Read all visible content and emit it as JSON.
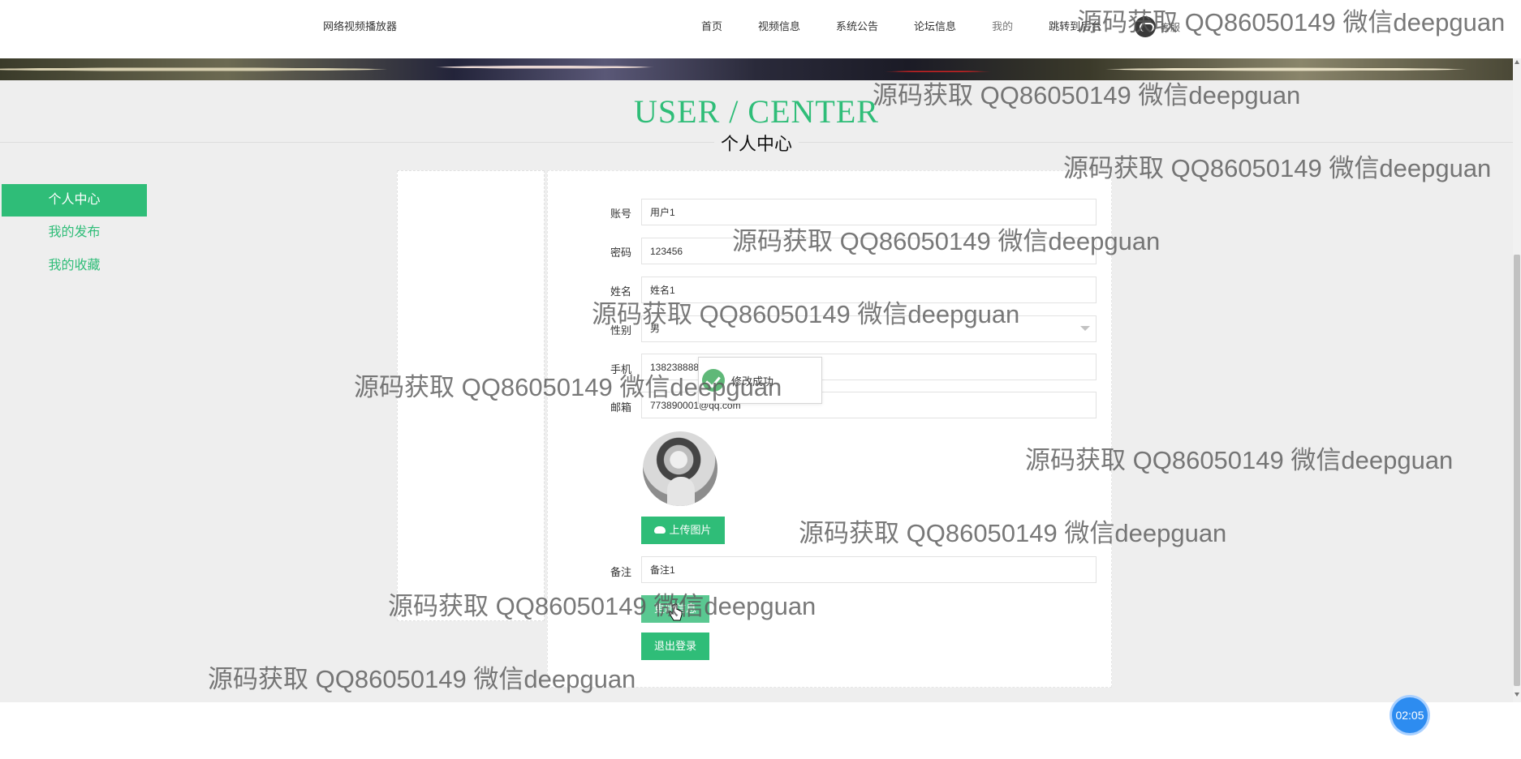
{
  "nav": {
    "brand": "网络视频播放器",
    "items": [
      "首页",
      "视频信息",
      "系统公告",
      "论坛信息",
      "我的",
      "跳转到后台"
    ],
    "customer_service": "客服"
  },
  "heading": {
    "en": "USER / CENTER",
    "cn": "个人中心"
  },
  "sidebar": {
    "items": [
      "个人中心",
      "我的发布",
      "我的收藏"
    ],
    "active_index": 0
  },
  "form": {
    "account": {
      "label": "账号",
      "value": "用户1"
    },
    "password": {
      "label": "密码",
      "value": "123456"
    },
    "name": {
      "label": "姓名",
      "value": "姓名1"
    },
    "gender": {
      "label": "性别",
      "value": "男"
    },
    "phone": {
      "label": "手机",
      "value": "13823888881"
    },
    "email": {
      "label": "邮箱",
      "value": "773890001@qq.com"
    },
    "remark": {
      "label": "备注",
      "value": "备注1"
    }
  },
  "buttons": {
    "upload": "上传图片",
    "update": "更新信息",
    "logout": "退出登录"
  },
  "toast": {
    "message": "修改成功"
  },
  "timer": "02:05",
  "watermark": "源码获取 QQ86050149 微信deepguan",
  "colors": {
    "accent": "#2fbd78",
    "background": "#eeeeee",
    "timer": "#2d8cf0"
  },
  "icons": {
    "customer_service": "customer-service-icon",
    "upload": "cloud-upload-icon",
    "toast": "check-circle-icon",
    "select": "chevron-down-icon"
  }
}
